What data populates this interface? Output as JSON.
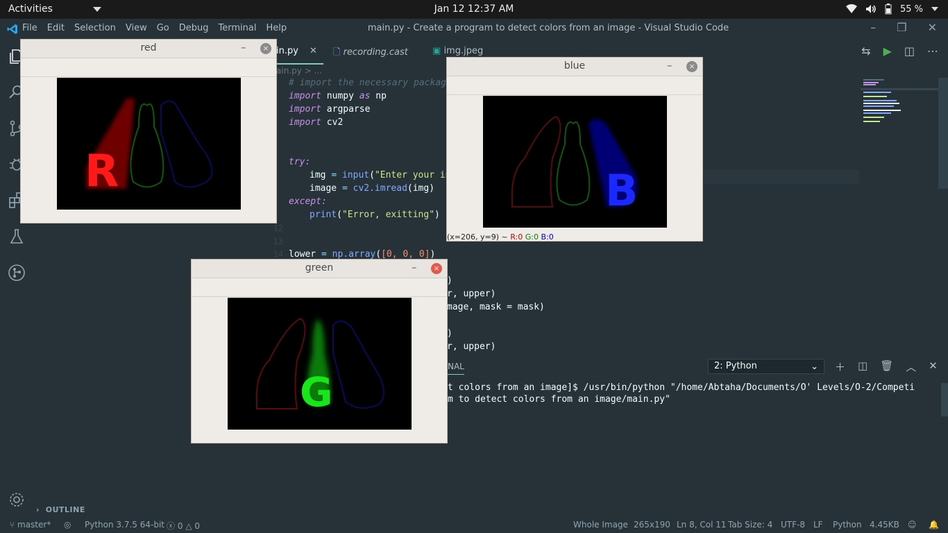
{
  "topbar": {
    "activities": "Activities",
    "clock": "Jan 12  12:37 AM",
    "battery": "55 %"
  },
  "titlebar": {
    "menu": [
      "File",
      "Edit",
      "Selection",
      "View",
      "Go",
      "Debug",
      "Terminal",
      "Help"
    ],
    "title": "main.py - Create a program to detect colors from an image - Visual Studio Code"
  },
  "tabs": [
    {
      "label": "in.py",
      "active": true
    },
    {
      "label": "recording.cast",
      "active": false
    },
    {
      "label": "img.jpeg",
      "active": false
    }
  ],
  "breadcrumb": "ain.py > ...",
  "code": {
    "comment": "# import the necessary package",
    "l2": [
      "import",
      "numpy",
      "as",
      "np"
    ],
    "l3": [
      "import",
      "argparse"
    ],
    "l4": [
      "import",
      "cv2"
    ],
    "try": "try:",
    "l8a": "img",
    "l8b": "input",
    "l8c": "\"Enter your in",
    "l9a": "image",
    "l9b": "cv2.imread",
    "l9c": "img",
    "except": "except:",
    "l11a": "print",
    "l11b": "\"Error, exitting\"",
    "ln12": "12",
    "ln13": "13",
    "ln14": "14",
    "l14a": "lower",
    "l14b": "np.array",
    "l14c": "[0, 0, 0]",
    "p1": ")",
    "p2": "r, upper)",
    "p3": "mage, mask = mask)",
    "p4": ")",
    "p5": "r, upper)"
  },
  "panel": {
    "tab": "NAL",
    "terminal_select": "2: Python"
  },
  "terminal": {
    "line1": "t colors from an image]$ /usr/bin/python \"/home/Abtaha/Documents/O' Levels/O-2/Competi",
    "line2": "m to detect colors from an image/main.py\""
  },
  "outline": "OUTLINE",
  "status": {
    "branch": "master*",
    "python": "Python 3.7.5 64-bit",
    "problems": "0",
    "warnings": "0",
    "whole_image": "Whole Image",
    "dims": "265x190",
    "position": "Ln 8, Col 11",
    "tabsize": "Tab Size: 4",
    "encoding": "UTF-8",
    "eol": "LF",
    "language": "Python",
    "size": "4.45KB"
  },
  "windows": {
    "red": {
      "title": "red",
      "letter": "R",
      "color": "#ff1a1a"
    },
    "blue": {
      "title": "blue",
      "letter": "B",
      "color": "#1a2aff",
      "status": "(x=206, y=9) ~ ",
      "r": "R:0",
      "g": "G:0",
      "b": "B:0"
    },
    "green": {
      "title": "green",
      "letter": "G",
      "color": "#19e619"
    }
  },
  "colors": {
    "bg": "#263238",
    "accent": "#80cbc4"
  }
}
